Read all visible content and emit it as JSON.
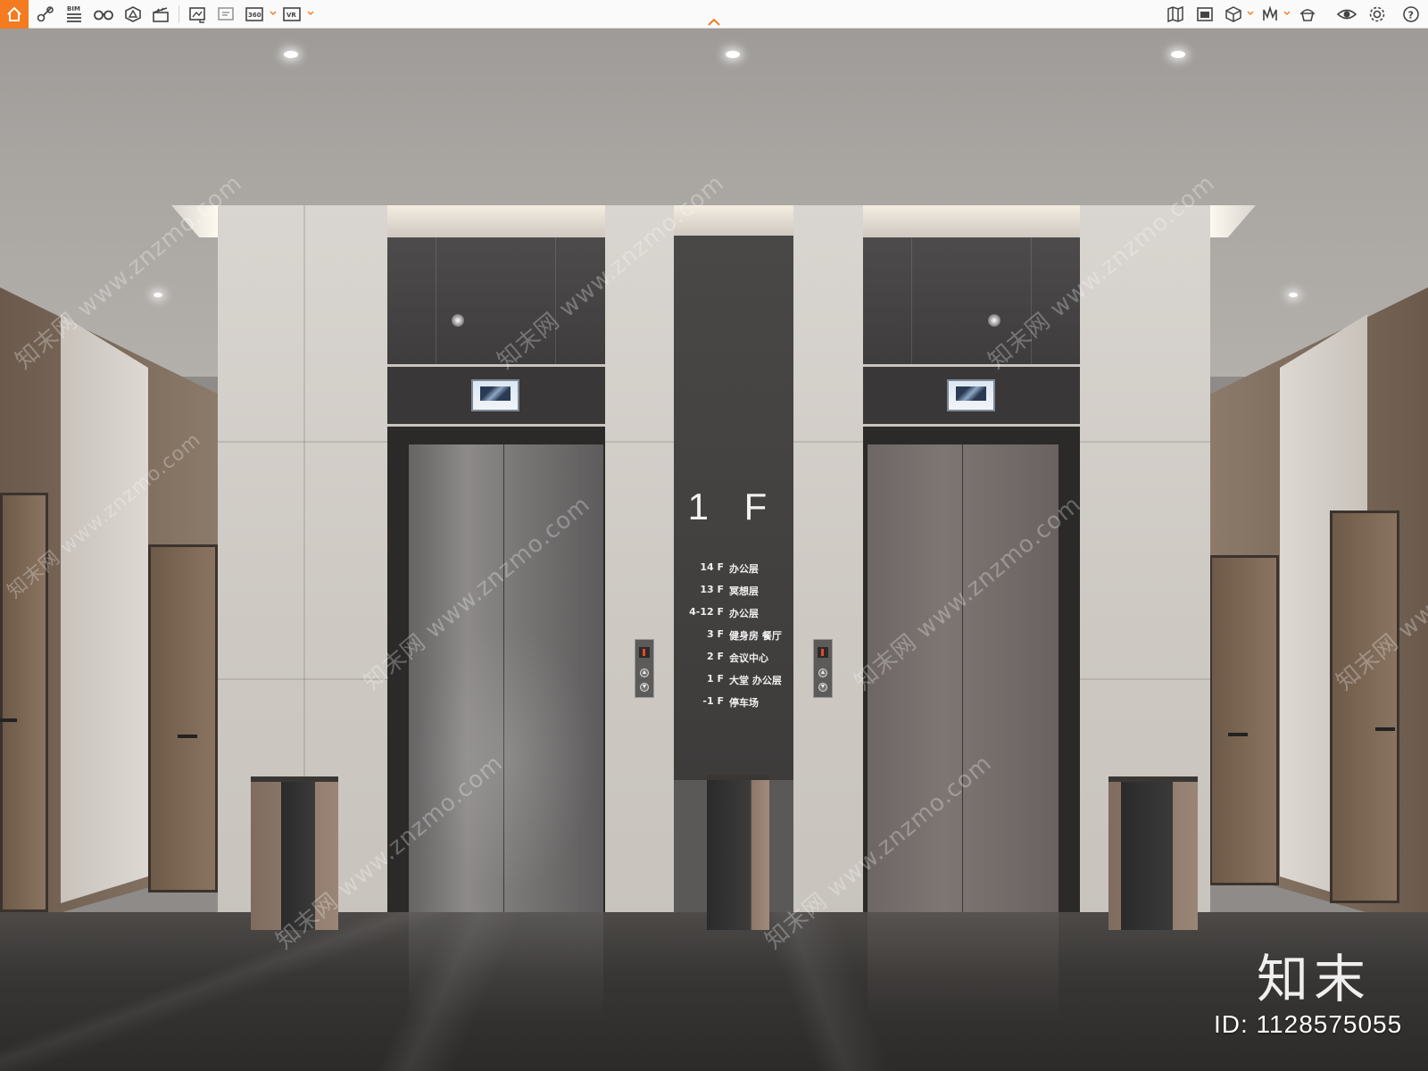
{
  "toolbar": {
    "home": {
      "icon": "home-icon",
      "color": "#f47b20"
    },
    "left_tools": [
      {
        "icon": "measure-icon"
      },
      {
        "icon": "bim-list-icon",
        "label": "BIM"
      },
      {
        "icon": "binoculars-icon"
      },
      {
        "icon": "explode-model-icon"
      },
      {
        "icon": "clapboard-icon"
      },
      {
        "icon": "image-compare-icon"
      },
      {
        "icon": "sticky-note-icon"
      },
      {
        "icon": "view-360-icon",
        "label": "360"
      },
      {
        "icon": "vr-icon",
        "label": "VR"
      }
    ],
    "right_tools": [
      {
        "icon": "map-icon"
      },
      {
        "icon": "screenshot-icon"
      },
      {
        "icon": "cube-view-icon"
      },
      {
        "icon": "walk-mode-icon"
      },
      {
        "icon": "clean-icon"
      },
      {
        "icon": "visibility-icon"
      },
      {
        "icon": "settings-icon"
      },
      {
        "icon": "help-icon"
      }
    ]
  },
  "signage": {
    "current_floor": "1 F",
    "directory": [
      {
        "floor": "14 F",
        "name": "办公层"
      },
      {
        "floor": "13 F",
        "name": "冥想层"
      },
      {
        "floor": "4-12 F",
        "name": "办公层"
      },
      {
        "floor": "3 F",
        "name": "健身房 餐厅"
      },
      {
        "floor": "2 F",
        "name": "会议中心"
      },
      {
        "floor": "1 F",
        "name": "大堂 办公层"
      },
      {
        "floor": "-1 F",
        "name": "停车场"
      }
    ]
  },
  "watermark": {
    "text": "知末网 www.znzmo.com",
    "logo": "知末",
    "id": "ID: 1128575055"
  }
}
